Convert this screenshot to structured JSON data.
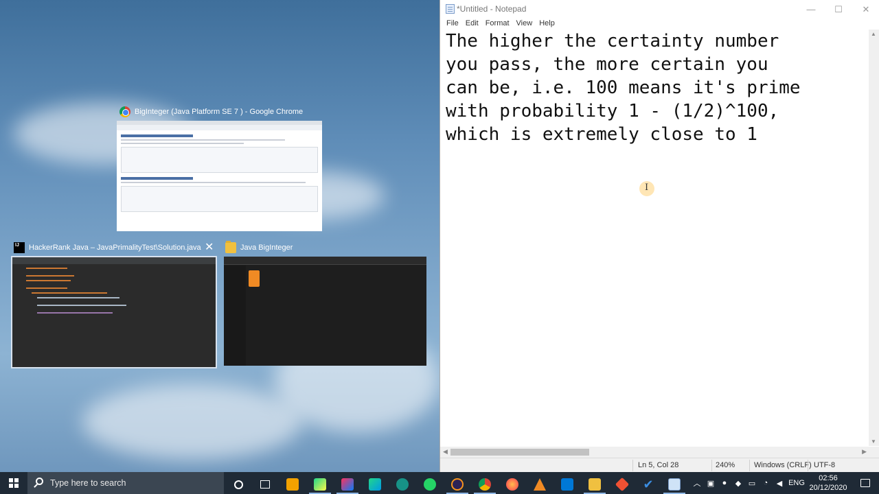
{
  "snap_assist": {
    "windows": [
      {
        "title": "BigInteger (Java Platform SE 7 ) - Google Chrome",
        "icon": "chrome-icon"
      },
      {
        "title": "HackerRank Java – JavaPrimalityTest\\Solution.java",
        "icon": "intellij-icon"
      },
      {
        "title": "Java BigInteger",
        "icon": "folder-icon"
      }
    ]
  },
  "notepad": {
    "title": "*Untitled - Notepad",
    "menu": [
      "File",
      "Edit",
      "Format",
      "View",
      "Help"
    ],
    "text": "The higher the certainty number\nyou pass, the more certain you\ncan be, i.e. 100 means it's prime\nwith probability 1 - (1/2)^100,\nwhich is extremely close to 1",
    "status": {
      "position": "Ln 5, Col 28",
      "zoom": "240%",
      "line_ending": "Windows (CRLF)",
      "encoding": "UTF-8"
    }
  },
  "taskbar": {
    "search_placeholder": "Type here to search",
    "pinned": [
      "cortana-icon",
      "task-view-icon",
      "store-icon",
      "pycharm-icon",
      "intellij-icon",
      "clion-icon",
      "gitkraken-icon",
      "whatsapp-icon",
      "eclipse-icon",
      "chrome-icon",
      "firefox-icon",
      "vlc-icon",
      "photos-icon",
      "file-explorer-icon",
      "git-icon",
      "todo-icon",
      "notepad-icon"
    ],
    "tray": {
      "language": "ENG",
      "time": "02:56",
      "date": "20/12/2020"
    }
  },
  "colors": {
    "taskbar": "#1f2a36",
    "search": "#3b4652",
    "accent": "#8fb8e6"
  }
}
